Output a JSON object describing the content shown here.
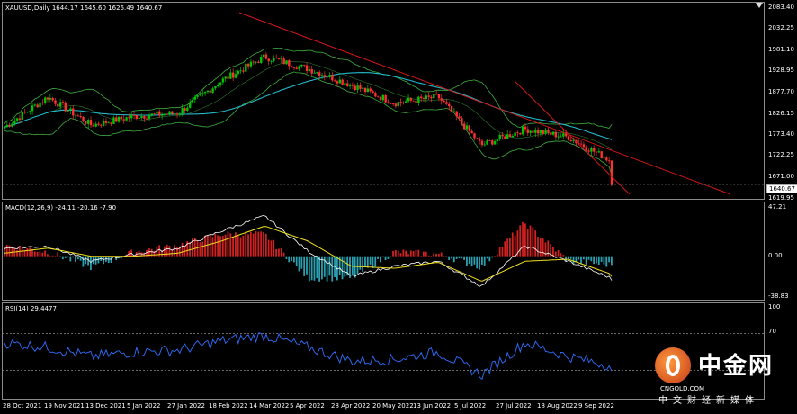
{
  "panels": {
    "price": {
      "label": "XAUUSD,Daily  1644.17 1645.60 1626.49 1640.67",
      "yticks": [
        "2083.40",
        "2032.25",
        "1981.10",
        "1928.95",
        "1877.70",
        "1826.15",
        "1773.40",
        "1722.25",
        "1671.00"
      ],
      "last_price": "1640.67",
      "low_tick": "1619.95"
    },
    "macd": {
      "label": "MACD(12,26,9) -24.11 -20.16 -7.90",
      "yticks": [
        "47.21",
        "0.00",
        "-38.83"
      ]
    },
    "rsi": {
      "label": "RSI(14) 29.4477",
      "yticks": [
        "100",
        "70",
        "30",
        "0"
      ]
    }
  },
  "xaxis": {
    "ticks": [
      "28 Oct 2021",
      "19 Nov 2021",
      "13 Dec 2021",
      "5 Jan 2022",
      "27 Jan 2022",
      "18 Feb 2022",
      "14 Mar 2022",
      "5 Apr 2022",
      "28 Apr 2022",
      "20 May 2022",
      "13 Jun 2022",
      "5 Jul 2022",
      "27 Jul 2022",
      "18 Aug 2022",
      "9 Sep 2022"
    ]
  },
  "watermark": {
    "logo_text": "中金网",
    "url": "CNGOLD.COM",
    "subtitle": "中文财经新媒体"
  },
  "colors": {
    "bull_candle": "#00c400",
    "bear_candle": "#ff3030",
    "trendline": "#d01818",
    "bollinger": "#3fae3f",
    "ma_line": "#22b8c8",
    "macd_line": "#ffffff",
    "signal_line": "#f0e020",
    "hist_pos": "#d02020",
    "hist_neg": "#2aa0b0",
    "rsi_line": "#2f6fff"
  },
  "chart_data": [
    {
      "type": "line",
      "title": "XAUUSD,Daily",
      "ohlc_last": {
        "open": 1644.17,
        "high": 1645.6,
        "low": 1626.49,
        "close": 1640.67
      },
      "ylim": [
        1619.95,
        2083.4
      ],
      "x": [
        "28 Oct 2021",
        "19 Nov 2021",
        "13 Dec 2021",
        "5 Jan 2022",
        "27 Jan 2022",
        "18 Feb 2022",
        "14 Mar 2022",
        "5 Apr 2022",
        "28 Apr 2022",
        "20 May 2022",
        "13 Jun 2022",
        "5 Jul 2022",
        "27 Jul 2022",
        "18 Aug 2022",
        "9 Sep 2022"
      ],
      "series": [
        {
          "name": "Close",
          "values": [
            1785,
            1860,
            1790,
            1812,
            1820,
            1900,
            1960,
            1930,
            1890,
            1845,
            1860,
            1740,
            1780,
            1760,
            1700
          ]
        }
      ],
      "x_end": "end",
      "y_end": 1640.67
    },
    {
      "type": "bar",
      "title": "MACD(12,26,9)",
      "ylim": [
        -38.83,
        47.21
      ],
      "x": [
        "28 Oct 2021",
        "19 Nov 2021",
        "13 Dec 2021",
        "5 Jan 2022",
        "27 Jan 2022",
        "18 Feb 2022",
        "14 Mar 2022",
        "5 Apr 2022",
        "28 Apr 2022",
        "20 May 2022",
        "13 Jun 2022",
        "5 Jul 2022",
        "27 Jul 2022",
        "18 Aug 2022",
        "9 Sep 2022"
      ],
      "series": [
        {
          "name": "MACD",
          "values": [
            8,
            10,
            -5,
            2,
            8,
            25,
            40,
            5,
            -20,
            -10,
            -5,
            -30,
            10,
            -5,
            -22
          ]
        },
        {
          "name": "Signal",
          "values": [
            3,
            8,
            0,
            0,
            3,
            15,
            30,
            15,
            -10,
            -12,
            -6,
            -25,
            -5,
            -3,
            -18
          ]
        }
      ],
      "last": {
        "macd": -24.11,
        "signal": -20.16,
        "hist": -7.9
      }
    },
    {
      "type": "line",
      "title": "RSI(14)",
      "ylim": [
        0,
        100
      ],
      "levels": [
        70,
        30
      ],
      "x": [
        "28 Oct 2021",
        "19 Nov 2021",
        "13 Dec 2021",
        "5 Jan 2022",
        "27 Jan 2022",
        "18 Feb 2022",
        "14 Mar 2022",
        "5 Apr 2022",
        "28 Apr 2022",
        "20 May 2022",
        "13 Jun 2022",
        "5 Jul 2022",
        "27 Jul 2022",
        "18 Aug 2022",
        "9 Sep 2022"
      ],
      "series": [
        {
          "name": "RSI",
          "values": [
            60,
            55,
            45,
            50,
            52,
            62,
            68,
            55,
            40,
            42,
            50,
            25,
            60,
            45,
            35
          ]
        }
      ],
      "last": 29.4477
    }
  ]
}
